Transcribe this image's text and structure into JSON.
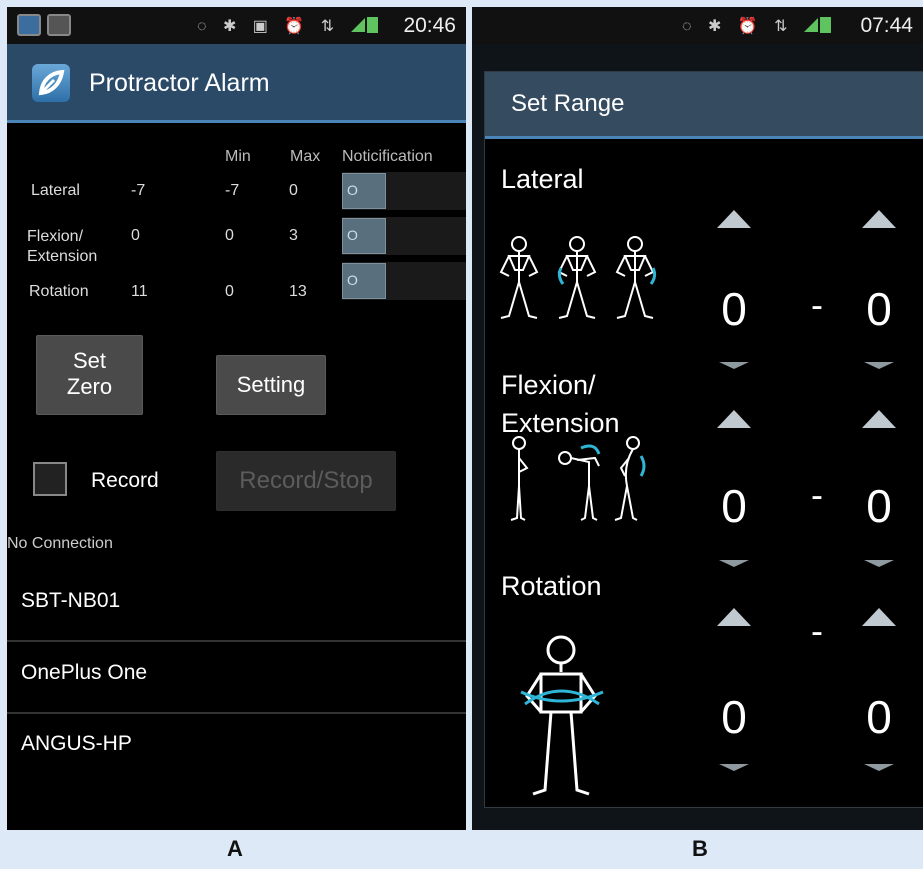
{
  "panel_a": {
    "status": {
      "time": "20:46"
    },
    "app_title": "Protractor Alarm",
    "table": {
      "headers": {
        "min": "Min",
        "max": "Max",
        "notification": "Noticification"
      },
      "rows": [
        {
          "label": "Lateral",
          "value": "-7",
          "min": "-7",
          "max": "0",
          "switch_state": "O"
        },
        {
          "label": "Flexion/\nExtension",
          "value": "0",
          "min": "0",
          "max": "3",
          "switch_state": "O"
        },
        {
          "label": "Rotation",
          "value": "11",
          "min": "0",
          "max": "13",
          "switch_state": "O"
        }
      ]
    },
    "buttons": {
      "set_zero": "Set\nZero",
      "setting": "Setting",
      "record_label": "Record",
      "record_stop": "Record/Stop"
    },
    "connection_status": "No Connection",
    "devices": [
      "SBT-NB01",
      "OnePlus One",
      "ANGUS-HP"
    ]
  },
  "panel_b": {
    "status": {
      "time": "07:44"
    },
    "dialog_title": "Set Range",
    "sections": [
      {
        "label": "Lateral",
        "min": "0",
        "max": "0",
        "separator": "-"
      },
      {
        "label": "Flexion/\nExtension",
        "min": "0",
        "max": "0",
        "separator": "-"
      },
      {
        "label": "Rotation",
        "min": "0",
        "max": "0",
        "separator": "-"
      }
    ]
  },
  "captions": {
    "a": "A",
    "b": "B"
  },
  "colors": {
    "actionbar": "#2b4a68",
    "accent": "#4b85b8",
    "figure_arrow": "#2fb5d6"
  }
}
